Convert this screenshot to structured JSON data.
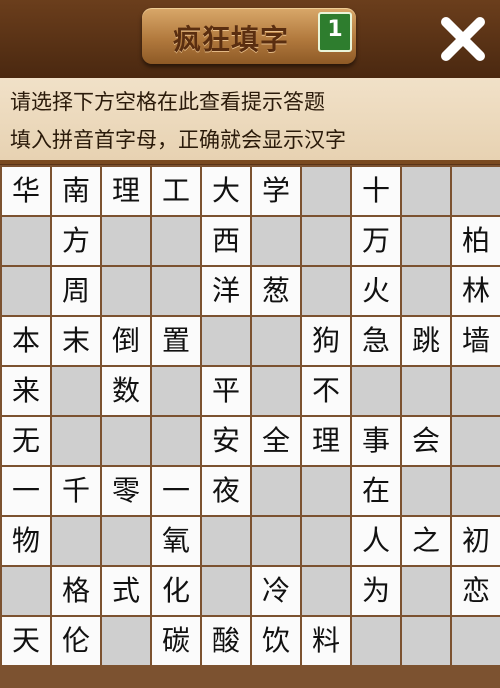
{
  "header": {
    "title": "疯狂填字",
    "level": "1"
  },
  "hint": {
    "line1": "请选择下方空格在此查看提示答题",
    "line2": "填入拼音首字母，正确就会显示汉字"
  },
  "grid": [
    [
      "华",
      "南",
      "理",
      "工",
      "大",
      "学",
      "",
      "十",
      "",
      ""
    ],
    [
      "",
      "方",
      "",
      "",
      "西",
      "",
      "",
      "万",
      "",
      "柏"
    ],
    [
      "",
      "周",
      "",
      "",
      "洋",
      "葱",
      "",
      "火",
      "",
      "林"
    ],
    [
      "本",
      "末",
      "倒",
      "置",
      "",
      "",
      "狗",
      "急",
      "跳",
      "墙"
    ],
    [
      "来",
      "",
      "数",
      "",
      "平",
      "",
      "不",
      "",
      "",
      ""
    ],
    [
      "无",
      "",
      "",
      "",
      "安",
      "全",
      "理",
      "事",
      "会",
      ""
    ],
    [
      "一",
      "千",
      "零",
      "一",
      "夜",
      "",
      "",
      "在",
      "",
      ""
    ],
    [
      "物",
      "",
      "",
      "氧",
      "",
      "",
      "",
      "人",
      "之",
      "初"
    ],
    [
      "",
      "格",
      "式",
      "化",
      "",
      "冷",
      "",
      "为",
      "",
      "恋"
    ],
    [
      "天",
      "伦",
      "",
      "碳",
      "酸",
      "饮",
      "料",
      "",
      "",
      ""
    ]
  ]
}
